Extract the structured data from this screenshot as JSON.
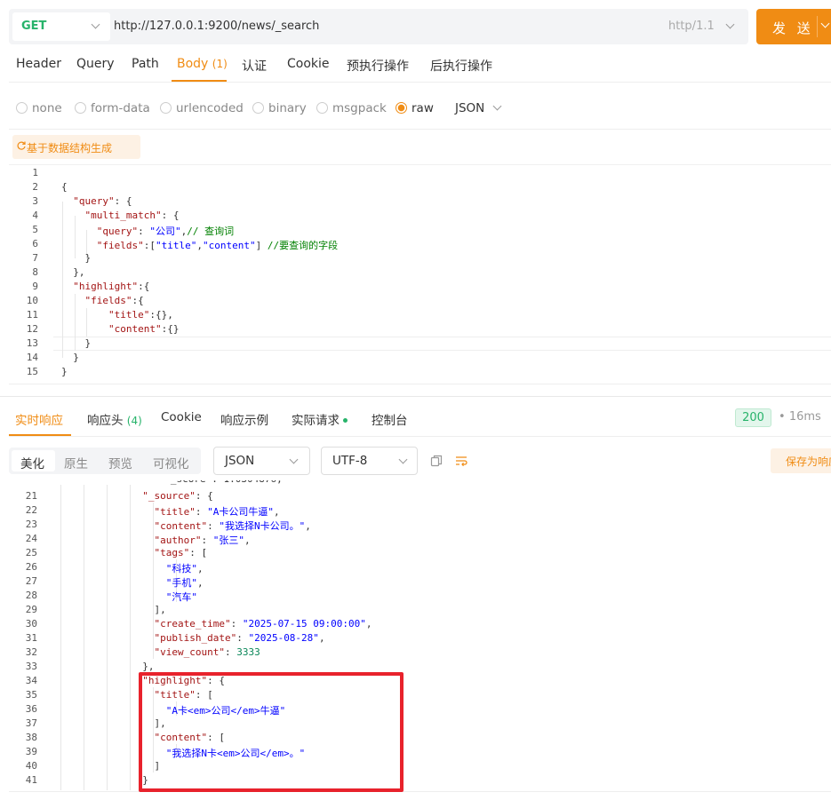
{
  "request": {
    "method": "GET",
    "url": "http://127.0.0.1:9200/news/_search",
    "http_version": "http/1.1",
    "send_label": "发 送"
  },
  "tabs": [
    {
      "label": "Header"
    },
    {
      "label": "Query"
    },
    {
      "label": "Path"
    },
    {
      "label": "Body",
      "badge": "(1)"
    },
    {
      "label": "认证"
    },
    {
      "label": "Cookie"
    },
    {
      "label": "预执行操作"
    },
    {
      "label": "后执行操作"
    }
  ],
  "body_types": [
    "none",
    "form-data",
    "urlencoded",
    "binary",
    "msgpack",
    "raw"
  ],
  "body_selected": "raw",
  "body_format": "JSON",
  "generate_label": "基于数据结构生成",
  "request_lines": [
    {
      "n": "1",
      "t": ""
    },
    {
      "n": "2",
      "t": "{"
    },
    {
      "n": "3",
      "t": "  \"query\": {"
    },
    {
      "n": "4",
      "t": "    \"multi_match\": {"
    },
    {
      "n": "5",
      "t": "      \"query\": \"公司\",// 查询词"
    },
    {
      "n": "6",
      "t": "      \"fields\":[\"title\",\"content\"] //要查询的字段"
    },
    {
      "n": "7",
      "t": "    }"
    },
    {
      "n": "8",
      "t": "  },"
    },
    {
      "n": "9",
      "t": "  \"highlight\":{"
    },
    {
      "n": "10",
      "t": "    \"fields\":{"
    },
    {
      "n": "11",
      "t": "        \"title\":{},"
    },
    {
      "n": "12",
      "t": "        \"content\":{}"
    },
    {
      "n": "13",
      "t": "    }"
    },
    {
      "n": "14",
      "t": "  }"
    },
    {
      "n": "15",
      "t": "}"
    }
  ],
  "response_tabs": [
    {
      "label": "实时响应"
    },
    {
      "label": "响应头",
      "badge": "(4)"
    },
    {
      "label": "Cookie"
    },
    {
      "label": "响应示例"
    },
    {
      "label": "实际请求"
    },
    {
      "label": "控制台"
    }
  ],
  "status_code": "200",
  "time": "16ms",
  "view_modes": [
    "美化",
    "原生",
    "预览",
    "可视化"
  ],
  "response_format": "JSON",
  "encoding": "UTF-8",
  "save_label": "保存为响应",
  "response_lines": [
    {
      "n": "21",
      "t": "          \"_source\": {"
    },
    {
      "n": "22",
      "t": "            \"title\": \"A卡公司牛逼\","
    },
    {
      "n": "23",
      "t": "            \"content\": \"我选择N卡公司。\","
    },
    {
      "n": "24",
      "t": "            \"author\": \"张三\","
    },
    {
      "n": "25",
      "t": "            \"tags\": ["
    },
    {
      "n": "26",
      "t": "              \"科技\","
    },
    {
      "n": "27",
      "t": "              \"手机\","
    },
    {
      "n": "28",
      "t": "              \"汽车\""
    },
    {
      "n": "29",
      "t": "            ],"
    },
    {
      "n": "30",
      "t": "            \"create_time\": \"2025-07-15 09:00:00\","
    },
    {
      "n": "31",
      "t": "            \"publish_date\": \"2025-08-28\","
    },
    {
      "n": "32",
      "t": "            \"view_count\": 3333"
    },
    {
      "n": "33",
      "t": "          },"
    },
    {
      "n": "34",
      "t": "          \"highlight\": {"
    },
    {
      "n": "35",
      "t": "            \"title\": ["
    },
    {
      "n": "36",
      "t": "              \"A卡<em>公司</em>牛逼\""
    },
    {
      "n": "37",
      "t": "            ],"
    },
    {
      "n": "38",
      "t": "            \"content\": ["
    },
    {
      "n": "39",
      "t": "              \"我选择N卡<em>公司</em>。\""
    },
    {
      "n": "40",
      "t": "            ]"
    },
    {
      "n": "41",
      "t": "          }"
    }
  ],
  "colors": {
    "accent": "#f08c14",
    "success": "#27b36a",
    "highlight_box": "#e8222c"
  }
}
